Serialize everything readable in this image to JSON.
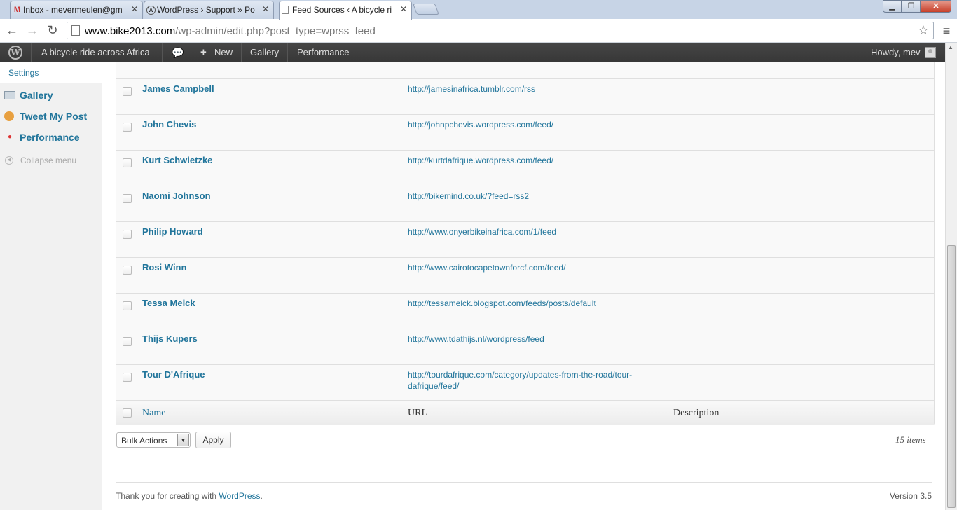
{
  "browser": {
    "tabs": [
      {
        "title": "Inbox - mevermeulen@gm",
        "icon": "gmail-icon"
      },
      {
        "title": "WordPress › Support » Po",
        "icon": "wordpress-icon"
      },
      {
        "title": "Feed Sources ‹ A bicycle ri",
        "icon": "page-icon"
      }
    ],
    "url_host": "www.bike2013.com",
    "url_path": "/wp-admin/edit.php?post_type=wprss_feed"
  },
  "adminbar": {
    "site_name": "A bicycle ride across Africa",
    "new_label": "New",
    "gallery_label": "Gallery",
    "performance_label": "Performance",
    "howdy": "Howdy, mev"
  },
  "sidebar": {
    "settings_label": "Settings",
    "items": [
      {
        "label": "Gallery",
        "icon": "gallery-icon"
      },
      {
        "label": "Tweet My Post",
        "icon": "tweet-icon"
      },
      {
        "label": "Performance",
        "icon": "performance-icon"
      }
    ],
    "collapse_label": "Collapse menu"
  },
  "table": {
    "rows": [
      {
        "name": "James Campbell",
        "url": "http://jamesinafrica.tumblr.com/rss"
      },
      {
        "name": "John Chevis",
        "url": "http://johnpchevis.wordpress.com/feed/"
      },
      {
        "name": "Kurt Schwietzke",
        "url": "http://kurtdafrique.wordpress.com/feed/"
      },
      {
        "name": "Naomi Johnson",
        "url": "http://bikemind.co.uk/?feed=rss2"
      },
      {
        "name": "Philip Howard",
        "url": "http://www.onyerbikeinafrica.com/1/feed"
      },
      {
        "name": "Rosi Winn",
        "url": "http://www.cairotocapetownforcf.com/feed/"
      },
      {
        "name": "Tessa Melck",
        "url": "http://tessamelck.blogspot.com/feeds/posts/default"
      },
      {
        "name": "Thijs Kupers",
        "url": "http://www.tdathijs.nl/wordpress/feed"
      },
      {
        "name": "Tour D'Afrique",
        "url": "http://tourdafrique.com/category/updates-from-the-road/tour-dafrique/feed/"
      }
    ],
    "footer": {
      "name": "Name",
      "url": "URL",
      "description": "Description"
    }
  },
  "actions": {
    "bulk_label": "Bulk Actions",
    "apply_label": "Apply",
    "count": "15 items"
  },
  "footer": {
    "thanks_prefix": "Thank you for creating with ",
    "thanks_link": "WordPress",
    "thanks_suffix": ".",
    "version": "Version 3.5"
  }
}
